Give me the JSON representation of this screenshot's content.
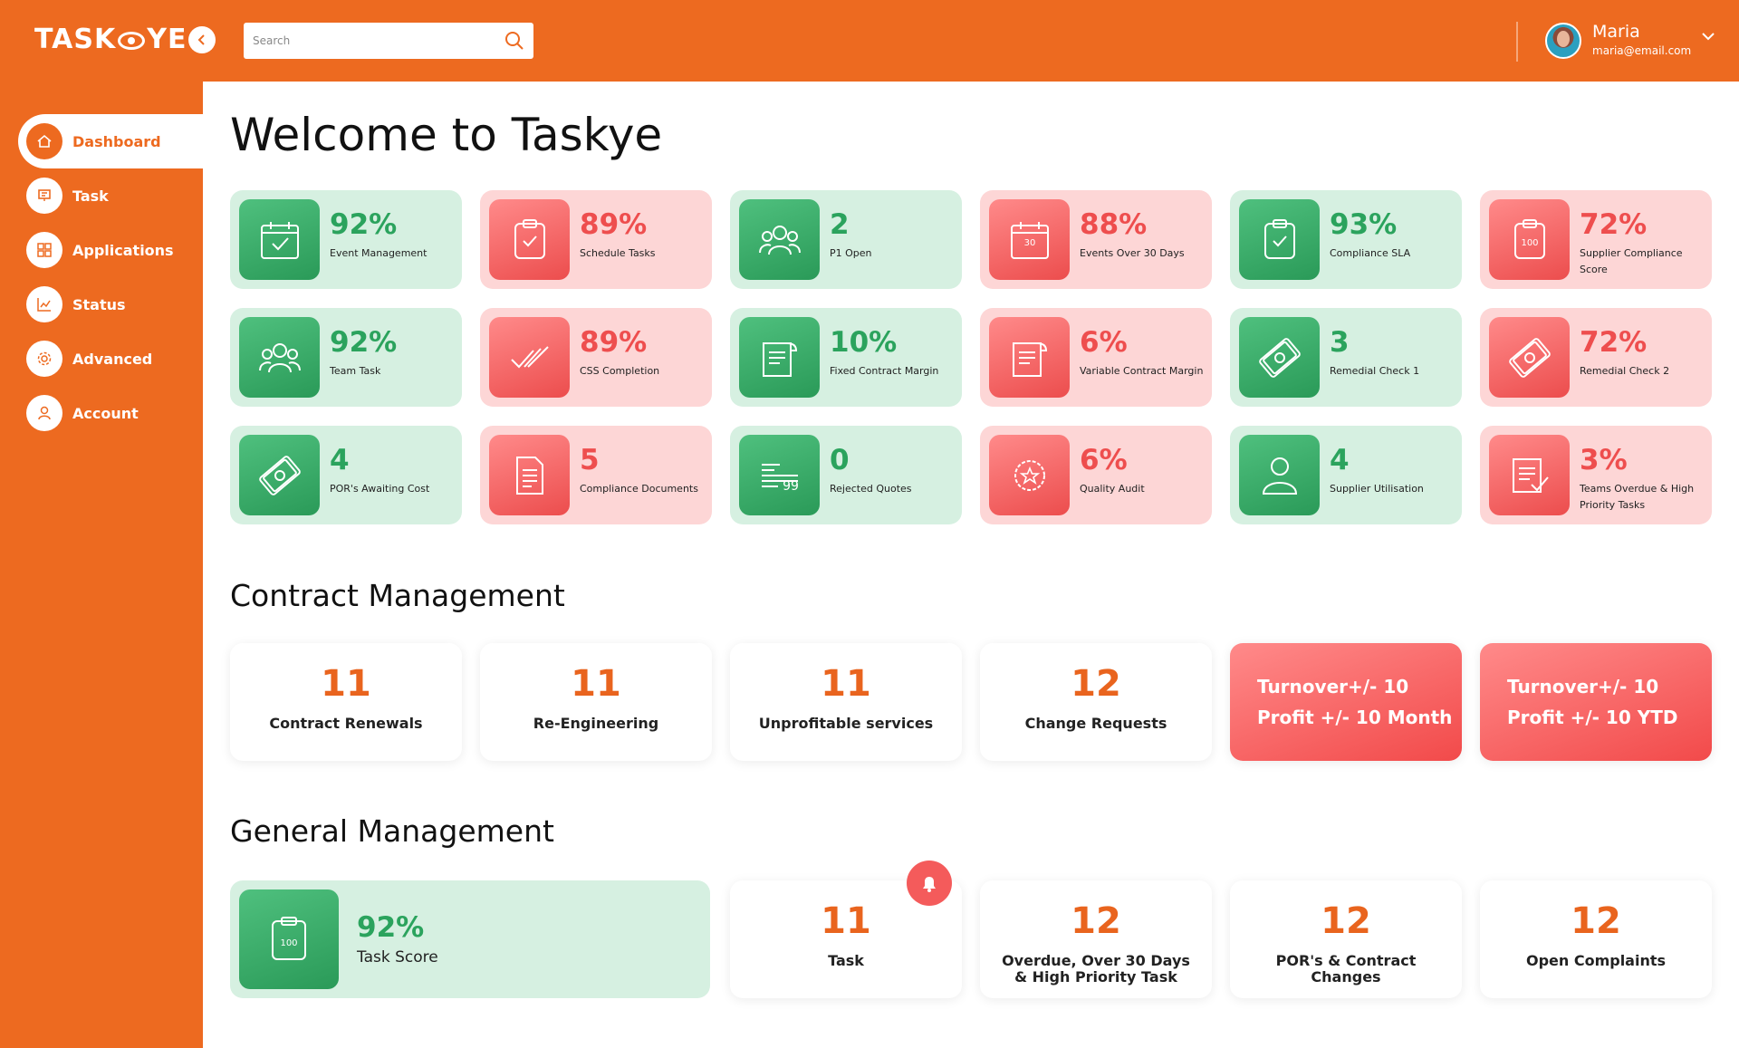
{
  "app": {
    "logo_text_left": "TASK",
    "logo_text_right": "YE",
    "search_placeholder": "Search",
    "user": {
      "name": "Maria",
      "email": "maria@email.com"
    }
  },
  "sidebar": {
    "items": [
      {
        "label": "Dashboard",
        "icon": "home-icon",
        "active": true
      },
      {
        "label": "Task",
        "icon": "task-icon"
      },
      {
        "label": "Applications",
        "icon": "applications-icon"
      },
      {
        "label": "Status",
        "icon": "status-chart-icon"
      },
      {
        "label": "Advanced",
        "icon": "gear-icon"
      },
      {
        "label": "Account",
        "icon": "user-icon"
      }
    ]
  },
  "main": {
    "title": "Welcome to Taskye",
    "kpis": [
      {
        "value": "92%",
        "label": "Event Management",
        "color": "green",
        "icon": "calendar-check-icon"
      },
      {
        "value": "89%",
        "label": "Schedule Tasks",
        "color": "red",
        "icon": "clipboard-check-icon"
      },
      {
        "value": "2",
        "label": "P1 Open",
        "color": "green",
        "icon": "team-icon"
      },
      {
        "value": "88%",
        "label": "Events Over 30 Days",
        "color": "red",
        "icon": "calendar-30-icon",
        "icon_text": "30"
      },
      {
        "value": "93%",
        "label": "Compliance SLA",
        "color": "green",
        "icon": "clipboard-check-icon"
      },
      {
        "value": "72%",
        "label": "Supplier Compliance Score",
        "color": "red",
        "icon": "clipboard-100-icon",
        "icon_text": "100"
      },
      {
        "value": "92%",
        "label": "Team Task",
        "color": "green",
        "icon": "team-icon"
      },
      {
        "value": "89%",
        "label": "CSS Completion",
        "color": "red",
        "icon": "double-check-icon"
      },
      {
        "value": "10%",
        "label": "Fixed Contract Margin",
        "color": "green",
        "icon": "contract-icon"
      },
      {
        "value": "6%",
        "label": "Variable Contract Margin",
        "color": "red",
        "icon": "contract-icon"
      },
      {
        "value": "3",
        "label": "Remedial Check 1",
        "color": "green",
        "icon": "money-icon"
      },
      {
        "value": "72%",
        "label": "Remedial Check  2",
        "color": "red",
        "icon": "money-icon"
      },
      {
        "value": "4",
        "label": "POR's Awaiting Cost",
        "color": "green",
        "icon": "money-icon"
      },
      {
        "value": "5",
        "label": "Compliance Documents",
        "color": "red",
        "icon": "document-icon"
      },
      {
        "value": "0",
        "label": "Rejected Quotes",
        "color": "green",
        "icon": "quotes-icon"
      },
      {
        "value": "6%",
        "label": "Quality Audit",
        "color": "red",
        "icon": "badge-star-icon"
      },
      {
        "value": "4",
        "label": "Supplier Utilisation",
        "color": "green",
        "icon": "user-icon"
      },
      {
        "value": "3%",
        "label": "Teams Overdue & High Priority Tasks",
        "color": "red",
        "icon": "list-check-icon"
      }
    ],
    "contract_title": "Contract Management",
    "contract": [
      {
        "value": "11",
        "label": "Contract Renewals"
      },
      {
        "value": "11",
        "label": "Re-Engineering"
      },
      {
        "value": "11",
        "label": "Unprofitable services"
      },
      {
        "value": "12",
        "label": "Change Requests"
      }
    ],
    "contract_red": [
      {
        "line1": "Turnover+/- 10",
        "line2": "Profit +/- 10 Month"
      },
      {
        "line1": "Turnover+/- 10",
        "line2": "Profit +/- 10 YTD"
      }
    ],
    "general_title": "General Management",
    "general_big": {
      "value": "92%",
      "label": "Task Score",
      "icon_text": "100"
    },
    "general": [
      {
        "value": "11",
        "label": "Task"
      },
      {
        "value": "12",
        "label": "Overdue, Over 30 Days & High Priority Task"
      },
      {
        "value": "12",
        "label": "POR's & Contract Changes"
      },
      {
        "value": "12",
        "label": "Open Complaints"
      }
    ]
  },
  "colors": {
    "brand": "#ED6A20",
    "green": "#2BA35D",
    "red": "#EE4E4E"
  }
}
